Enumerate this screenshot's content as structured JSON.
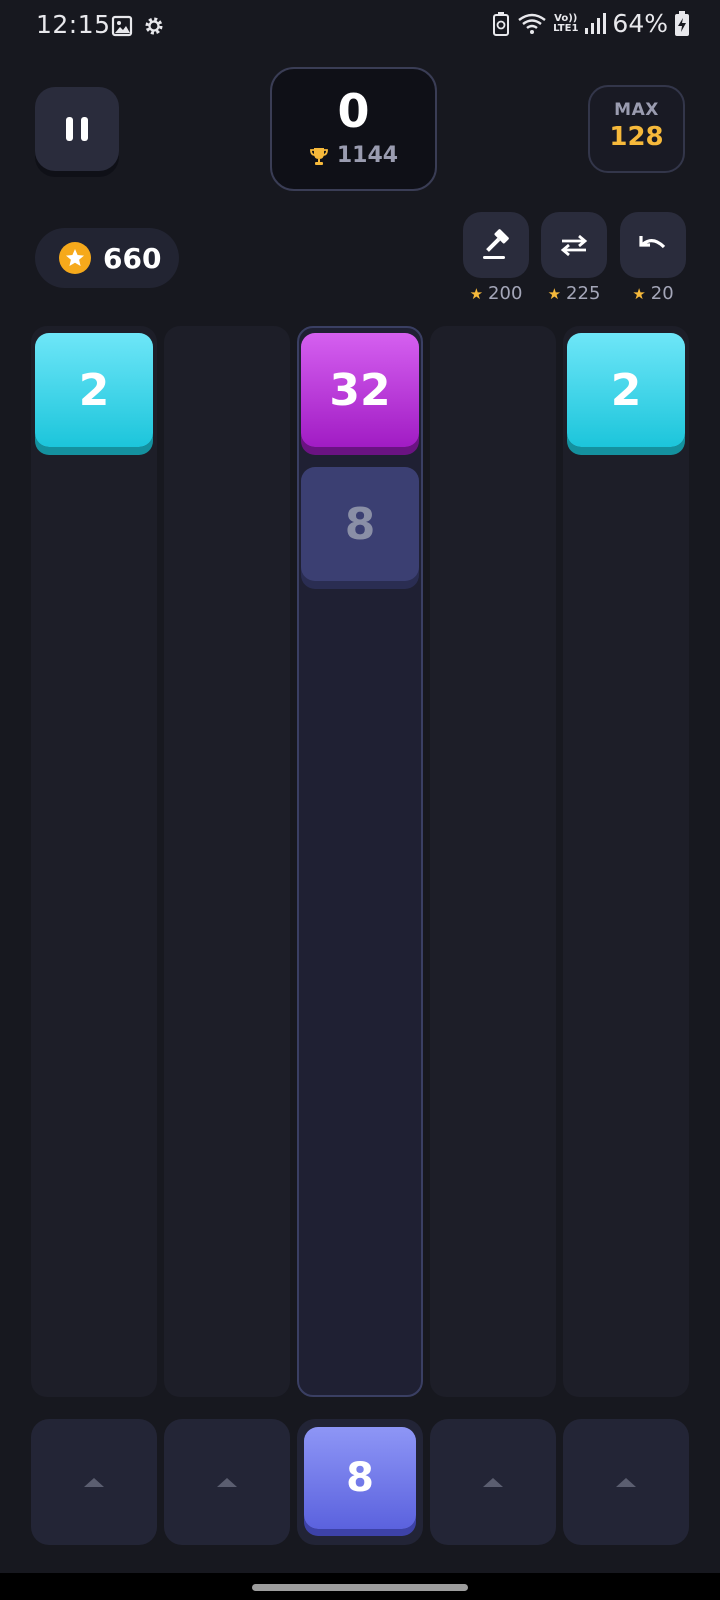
{
  "status_bar": {
    "time": "12:15",
    "battery_percent": "64%",
    "network_label_top": "Vo))",
    "network_label_bottom": "LTE1",
    "icons": [
      "gallery-icon",
      "settings-gear-icon",
      "battery-saver-icon",
      "wifi-icon",
      "signal-icon",
      "battery-charging-icon"
    ]
  },
  "header": {
    "score": "0",
    "best_score": "1144",
    "max_label": "MAX",
    "max_value": "128",
    "pause_icon": "pause-icon"
  },
  "wallet": {
    "coins": "660",
    "icon": "star-coin-icon"
  },
  "powerups": [
    {
      "name": "hammer",
      "icon": "hammer-icon",
      "cost": "200"
    },
    {
      "name": "swap",
      "icon": "swap-icon",
      "cost": "225"
    },
    {
      "name": "undo",
      "icon": "undo-icon",
      "cost": "20"
    }
  ],
  "board": {
    "columns": 5,
    "active_column": 3,
    "tiles": [
      {
        "column": 1,
        "row": 1,
        "value": "2"
      },
      {
        "column": 3,
        "row": 1,
        "value": "32"
      },
      {
        "column": 5,
        "row": 1,
        "value": "2"
      }
    ],
    "preview_tile": {
      "column": 3,
      "row": 2,
      "value": "8"
    }
  },
  "next_tile": {
    "value": "8",
    "column": 3
  },
  "colors": {
    "background": "#17181f",
    "tile_2": "#2fd3e8",
    "tile_32": "#b52fd8",
    "tile_8_next": "#6d74e8",
    "gold": "#f6b93b"
  }
}
